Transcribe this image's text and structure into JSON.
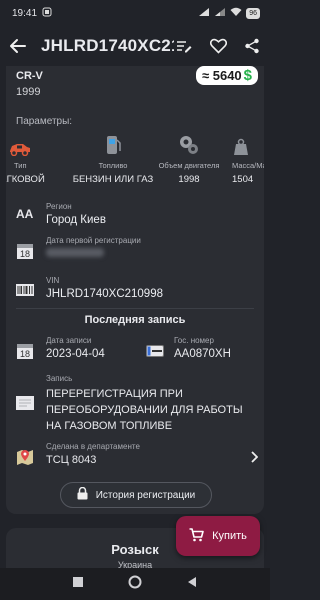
{
  "status": {
    "time": "19:41",
    "battery": "96"
  },
  "header": {
    "title": "JHLRD1740XC21..."
  },
  "car": {
    "model": "CR-V",
    "year": "1999",
    "price": "≈ 5640",
    "currency": "$"
  },
  "params": {
    "label": "Параметры:",
    "items": [
      {
        "label": "Тип",
        "value": "ЛЕГКОВОЙ"
      },
      {
        "label": "Топливо",
        "value": "БЕНЗИН ИЛИ ГАЗ"
      },
      {
        "label": "Объем двигателя",
        "value": "1998"
      },
      {
        "label": "Масса/Max",
        "value": "1504"
      }
    ]
  },
  "region": {
    "label": "Регион",
    "value": "Город Киев"
  },
  "first_registration": {
    "label": "Дата первой регистрации"
  },
  "vin": {
    "label": "VIN",
    "value": "JHLRD1740XC210998"
  },
  "last_record": {
    "title": "Последняя запись",
    "date_label": "Дата записи",
    "date_value": "2023-04-04",
    "plate_label": "Гос. номер",
    "plate_value": "AA0870XH",
    "record_label": "Запись",
    "record_value": [
      "ПЕРЕРЕГИСТРАЦИЯ ПРИ",
      "ПЕРЕОБОРУДОВАНИИ ДЛЯ РАБОТЫ",
      "НА ГАЗОВОМ ТОПЛИВЕ"
    ],
    "dept_label": "Сделана в департаменте",
    "dept_value": "ТСЦ 8043"
  },
  "history_button": "История регистрации",
  "search": {
    "title": "Розыск",
    "subtitle": "Украина"
  },
  "buy_button": "Купить"
}
